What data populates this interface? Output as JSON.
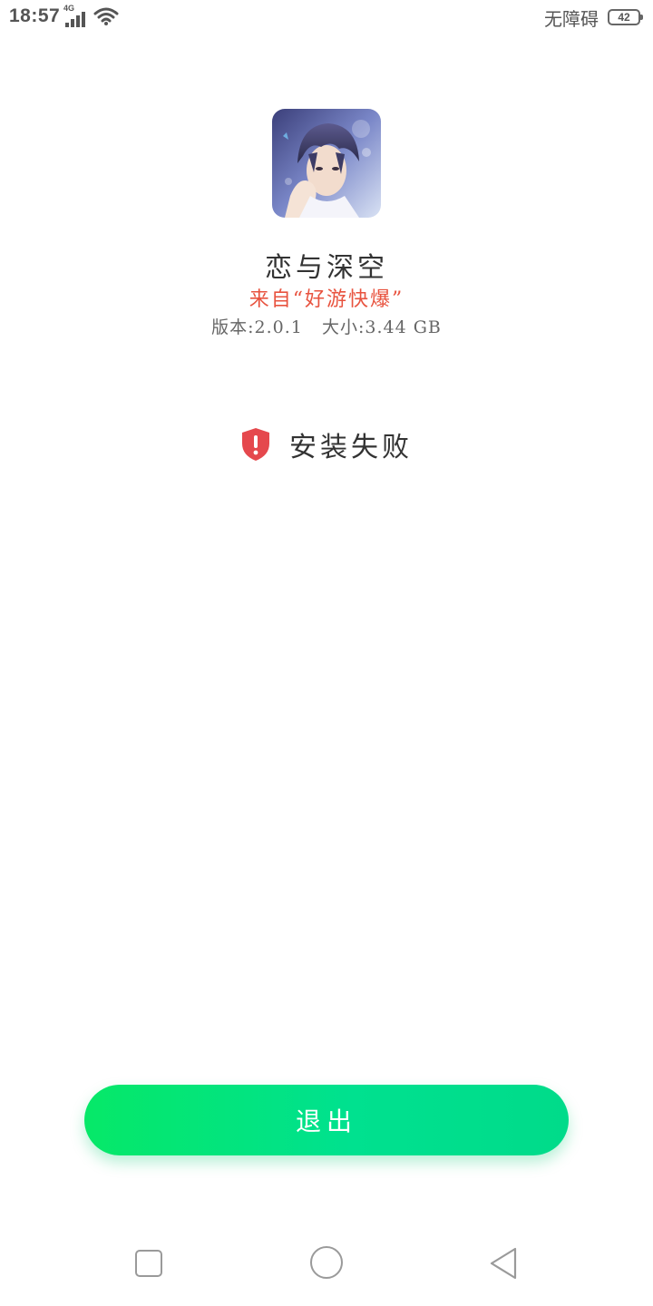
{
  "status_bar": {
    "time": "18:57",
    "network": "4G",
    "accessibility": "无障碍",
    "battery_level": "42"
  },
  "app": {
    "name": "恋与深空",
    "source": "来自“好游快爆”",
    "version_label": "版本:2.0.1",
    "size_label": "大小:3.44 GB"
  },
  "result": {
    "text": "安装失败",
    "icon": "shield-alert-icon",
    "icon_color": "#e5484d"
  },
  "actions": {
    "exit_label": "退出",
    "button_color": "#00e070"
  },
  "nav": {
    "recents": "square-icon",
    "home": "circle-icon",
    "back": "triangle-back-icon"
  }
}
